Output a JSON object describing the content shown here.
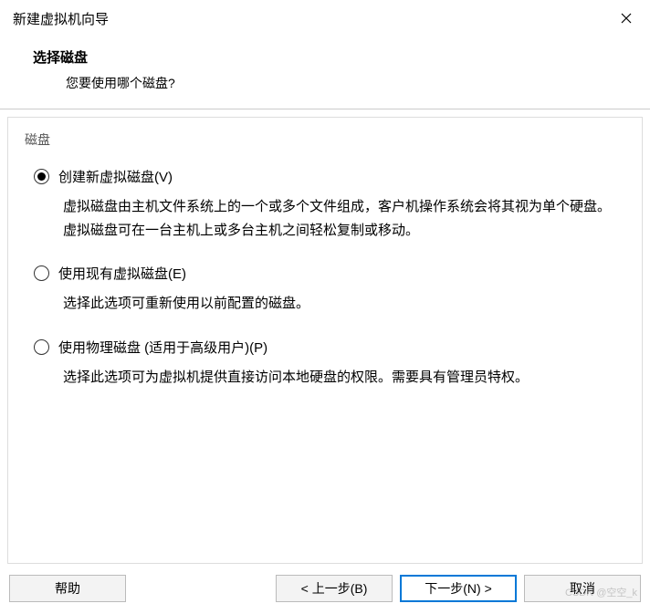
{
  "window": {
    "title": "新建虚拟机向导"
  },
  "header": {
    "title": "选择磁盘",
    "question": "您要使用哪个磁盘?"
  },
  "section": {
    "label": "磁盘"
  },
  "options": {
    "create": {
      "label": "创建新虚拟磁盘(V)",
      "desc": "虚拟磁盘由主机文件系统上的一个或多个文件组成，客户机操作系统会将其视为单个硬盘。虚拟磁盘可在一台主机上或多台主机之间轻松复制或移动。",
      "selected": true
    },
    "existing": {
      "label": "使用现有虚拟磁盘(E)",
      "desc": "选择此选项可重新使用以前配置的磁盘。",
      "selected": false
    },
    "physical": {
      "label": "使用物理磁盘 (适用于高级用户)(P)",
      "desc": "选择此选项可为虚拟机提供直接访问本地硬盘的权限。需要具有管理员特权。",
      "selected": false
    }
  },
  "buttons": {
    "help": "帮助",
    "back": "< 上一步(B)",
    "next": "下一步(N) >",
    "cancel": "取消"
  },
  "watermark": "CSDN @空空_k"
}
